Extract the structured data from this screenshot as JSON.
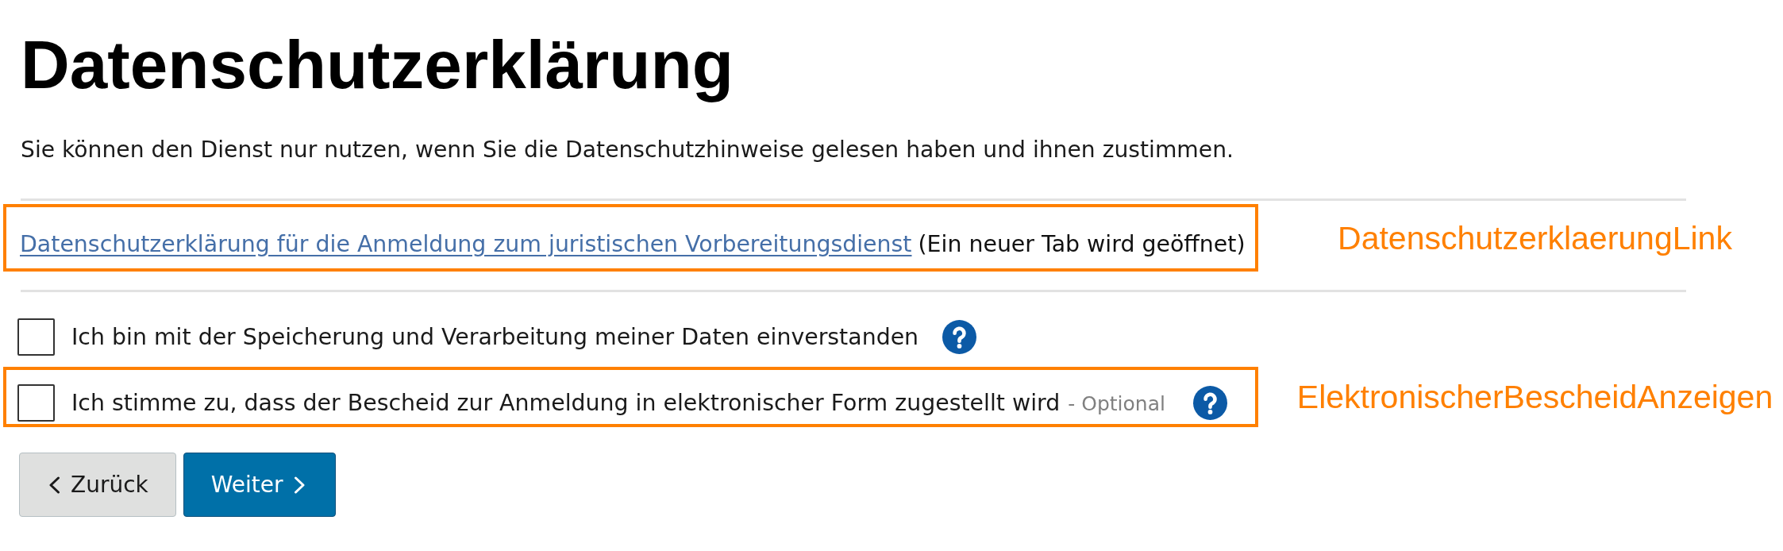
{
  "title": "Datenschutzerklärung",
  "intro": "Sie können den Dienst nur nutzen, wenn Sie die Datenschutzhinweise gelesen haben und ihnen zustimmen.",
  "privacy_link": {
    "label": "Datenschutzerklärung für die Anmeldung zum juristischen Vorbereitungsdienst",
    "note": "(Ein neuer Tab wird geöffnet)",
    "annotation": "DatenschutzerklaerungLink"
  },
  "consents": [
    {
      "label": "Ich bin mit der Speicherung und Verarbeitung meiner Daten einverstanden",
      "checked": false
    },
    {
      "label": "Ich stimme zu, dass der Bescheid zur Anmeldung in elektronischer Form zugestellt wird",
      "optional_tag": "- Optional",
      "checked": false,
      "annotation": "ElektronischerBescheidAnzeigen"
    }
  ],
  "buttons": [
    {
      "kind": "back",
      "label": "Zurück"
    },
    {
      "kind": "next",
      "label": "Weiter"
    }
  ]
}
